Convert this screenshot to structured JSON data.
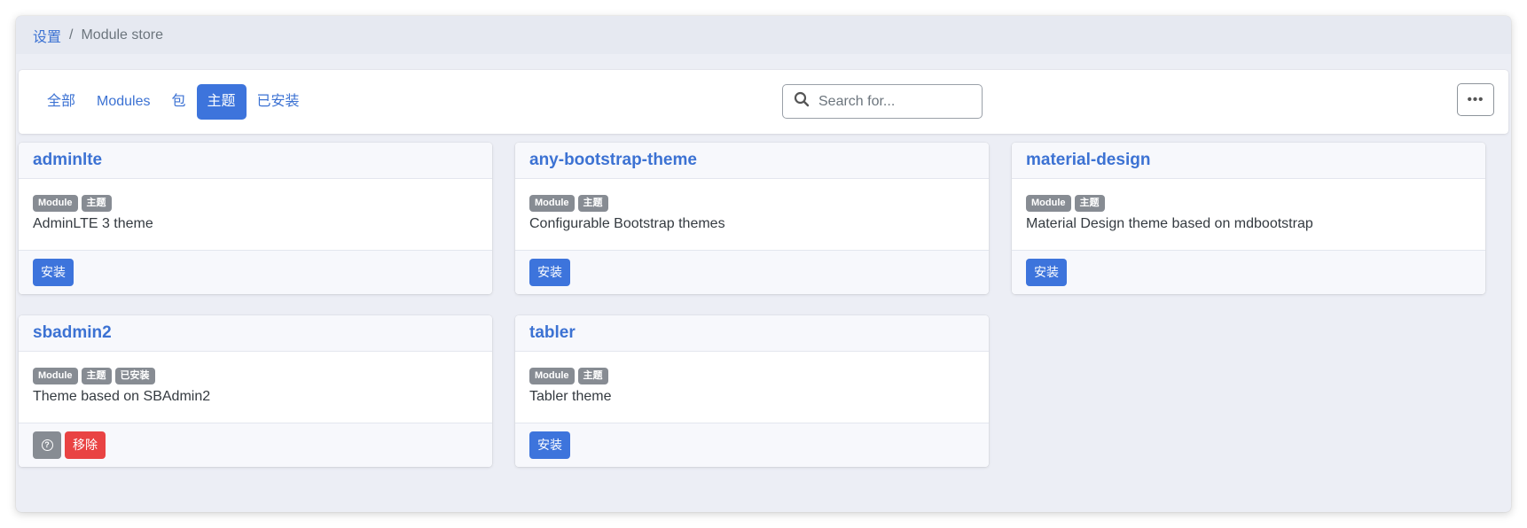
{
  "breadcrumb": {
    "root": "设置",
    "separator": "/",
    "current": "Module store"
  },
  "tabs": [
    {
      "label": "全部",
      "active": false
    },
    {
      "label": "Modules",
      "active": false
    },
    {
      "label": "包",
      "active": false
    },
    {
      "label": "主题",
      "active": true
    },
    {
      "label": "已安装",
      "active": false
    }
  ],
  "search": {
    "placeholder": "Search for..."
  },
  "more_button": {
    "label": "•••"
  },
  "modules": [
    {
      "name": "adminlte",
      "badges": [
        "Module",
        "主题"
      ],
      "description": "AdminLTE 3 theme",
      "actions": {
        "install": "安装"
      }
    },
    {
      "name": "any-bootstrap-theme",
      "badges": [
        "Module",
        "主题"
      ],
      "description": "Configurable Bootstrap themes",
      "actions": {
        "install": "安装"
      }
    },
    {
      "name": "material-design",
      "badges": [
        "Module",
        "主题"
      ],
      "description": "Material Design theme based on mdbootstrap",
      "actions": {
        "install": "安装"
      }
    },
    {
      "name": "sbadmin2",
      "badges": [
        "Module",
        "主题",
        "已安装"
      ],
      "description": "Theme based on SBAdmin2",
      "actions": {
        "help": "?",
        "remove": "移除"
      }
    },
    {
      "name": "tabler",
      "badges": [
        "Module",
        "主题"
      ],
      "description": "Tabler theme",
      "actions": {
        "install": "安装"
      }
    }
  ],
  "colors": {
    "primary": "#3d74dc",
    "danger": "#e94343",
    "badge": "#878c93",
    "link": "#3c72d3",
    "background": "#eceef5"
  }
}
